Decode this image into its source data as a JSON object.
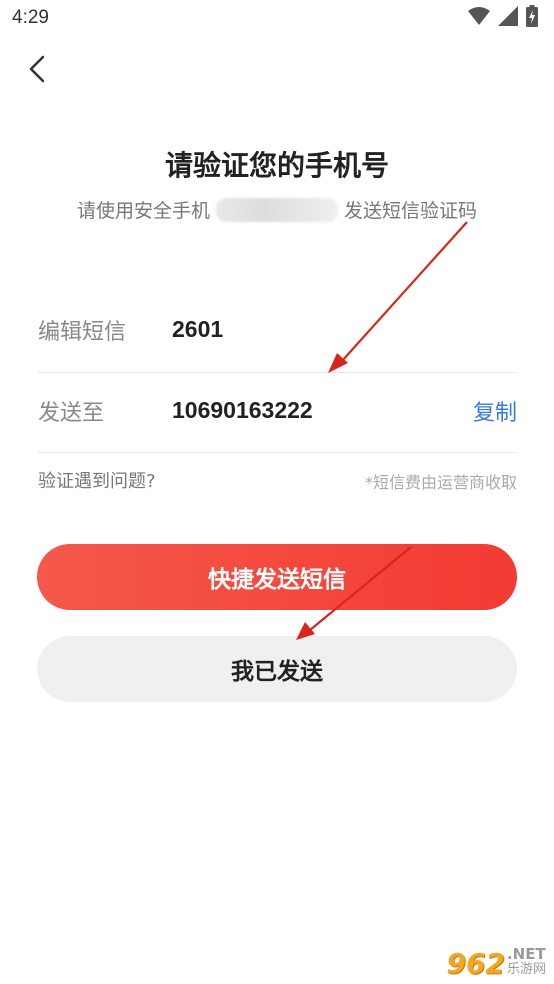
{
  "status_bar": {
    "time": "4:29",
    "icons": [
      "wifi-icon",
      "cellular-signal-icon",
      "battery-charging-icon"
    ]
  },
  "nav": {
    "back_icon": "chevron-left-icon"
  },
  "header": {
    "title": "请验证您的手机号",
    "subtitle_prefix": "请使用安全手机",
    "subtitle_suffix": "发送短信验证码"
  },
  "sms_form": {
    "message_label": "编辑短信",
    "message_value": "2601",
    "send_to_label": "发送至",
    "send_to_value": "10690163222",
    "copy_label": "复制"
  },
  "help": {
    "problem_link": "验证遇到问题?",
    "fee_note": "*短信费由运营商收取"
  },
  "actions": {
    "quick_send_label": "快捷发送短信",
    "already_sent_label": "我已发送"
  },
  "watermark": {
    "badge": "962",
    "net": ".NET",
    "cn": "乐游网"
  },
  "colors": {
    "accent_red": "#f33a33",
    "link_blue": "#3a7bd5",
    "annotation_arrow": "#d9261c"
  }
}
